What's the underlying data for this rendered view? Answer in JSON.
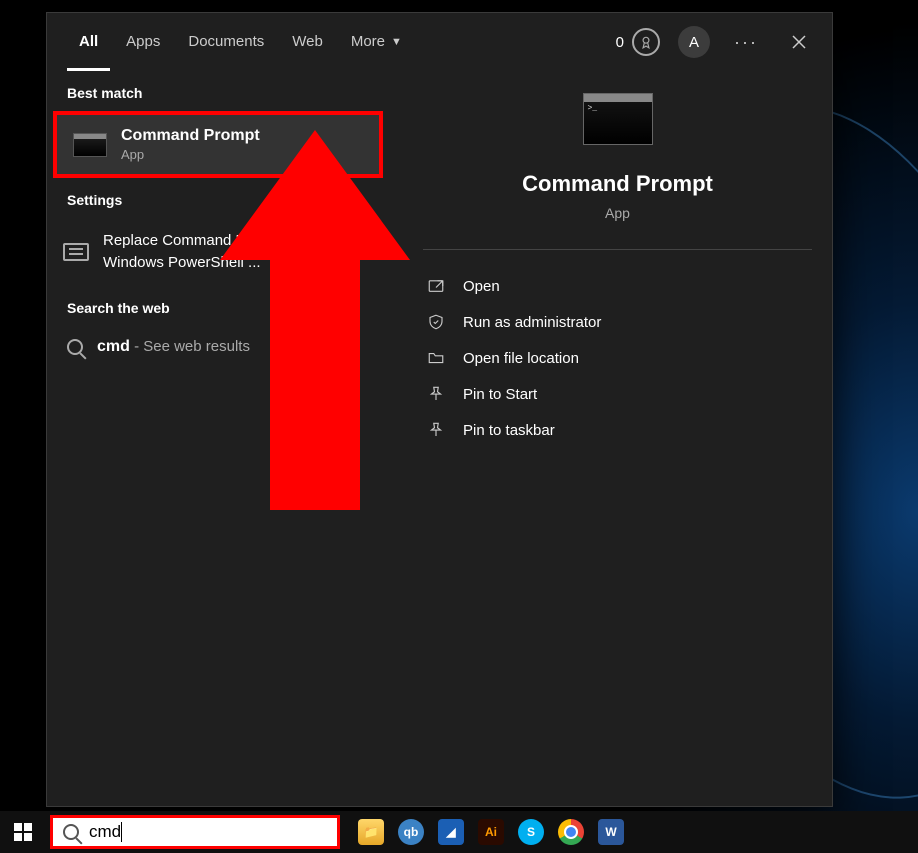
{
  "tabs": {
    "all": "All",
    "apps": "Apps",
    "documents": "Documents",
    "web": "Web",
    "more": "More"
  },
  "header": {
    "rewards_count": "0",
    "avatar_letter": "A"
  },
  "left": {
    "best_match_label": "Best match",
    "result_title": "Command Prompt",
    "result_sub": "App",
    "settings_label": "Settings",
    "settings_item": "Replace Command Prompt with Windows PowerShell ...",
    "web_label": "Search the web",
    "web_query": "cmd",
    "web_hint": " - See web results"
  },
  "right": {
    "title": "Command Prompt",
    "sub": "App",
    "actions": {
      "open": "Open",
      "run_admin": "Run as administrator",
      "open_loc": "Open file location",
      "pin_start": "Pin to Start",
      "pin_taskbar": "Pin to taskbar"
    }
  },
  "taskbar": {
    "search_value": "cmd"
  },
  "colors": {
    "highlight": "#ff0000"
  }
}
